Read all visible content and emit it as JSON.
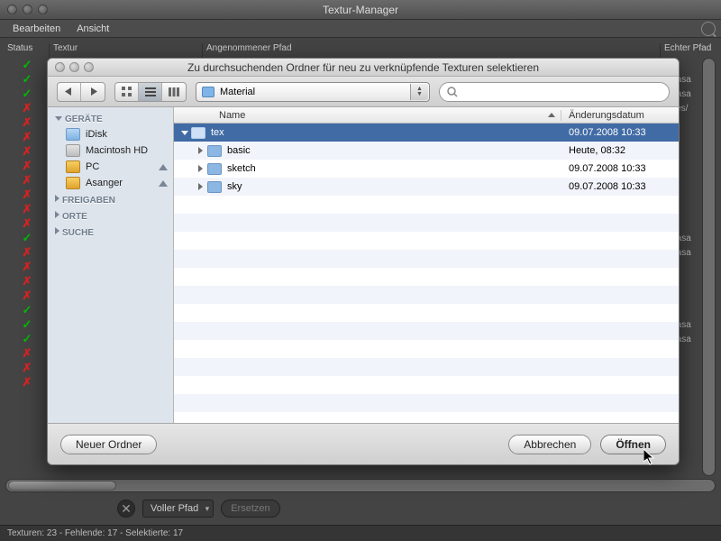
{
  "main": {
    "title": "Textur-Manager",
    "menu": {
      "edit": "Bearbeiten",
      "view": "Ansicht"
    },
    "columns": {
      "status": "Status",
      "textur": "Textur",
      "assumed": "Angenommener Pfad",
      "real": "Echter Pfad"
    },
    "status_rows": [
      {
        "ok": true,
        "path": ""
      },
      {
        "ok": true,
        "path": "ers/asa"
      },
      {
        "ok": true,
        "path": "ers/asa"
      },
      {
        "ok": false,
        "path": "lumes/"
      },
      {
        "ok": false,
        "path": ""
      },
      {
        "ok": false,
        "path": ""
      },
      {
        "ok": false,
        "path": ""
      },
      {
        "ok": false,
        "path": ""
      },
      {
        "ok": false,
        "path": ""
      },
      {
        "ok": false,
        "path": ""
      },
      {
        "ok": false,
        "path": ""
      },
      {
        "ok": false,
        "path": ""
      },
      {
        "ok": true,
        "path": "ers/asa"
      },
      {
        "ok": false,
        "path": "ers/asa"
      },
      {
        "ok": false,
        "path": ""
      },
      {
        "ok": false,
        "path": ""
      },
      {
        "ok": false,
        "path": ""
      },
      {
        "ok": true,
        "path": ""
      },
      {
        "ok": true,
        "path": "ers/asa"
      },
      {
        "ok": true,
        "path": "ers/asa"
      },
      {
        "ok": false,
        "path": ""
      },
      {
        "ok": false,
        "path": ""
      },
      {
        "ok": false,
        "path": ""
      }
    ],
    "path_mode": "Voller Pfad",
    "replace": "Ersetzen",
    "statusline": "Texturen: 23 - Fehlende: 17 - Selektierte: 17"
  },
  "dlg": {
    "title": "Zu durchsuchenden Ordner für neu zu verknüpfende Texturen selektieren",
    "location": "Material",
    "search_placeholder": "",
    "sidebar": {
      "devices": "GERÄTE",
      "shares": "FREIGABEN",
      "places": "ORTE",
      "search": "SUCHE",
      "items": [
        {
          "label": "iDisk",
          "icon": "idisk",
          "eject": false
        },
        {
          "label": "Macintosh HD",
          "icon": "hd",
          "eject": false
        },
        {
          "label": "PC",
          "icon": "pc",
          "eject": true
        },
        {
          "label": "Asanger",
          "icon": "as",
          "eject": true
        }
      ]
    },
    "list": {
      "col_name": "Name",
      "col_date": "Änderungsdatum",
      "rows": [
        {
          "name": "tex",
          "date": "09.07.2008 10:33",
          "expanded": true,
          "depth": 0,
          "selected": true
        },
        {
          "name": "basic",
          "date": "Heute, 08:32",
          "expanded": false,
          "depth": 1,
          "selected": false
        },
        {
          "name": "sketch",
          "date": "09.07.2008 10:33",
          "expanded": false,
          "depth": 1,
          "selected": false
        },
        {
          "name": "sky",
          "date": "09.07.2008 10:33",
          "expanded": false,
          "depth": 1,
          "selected": false
        }
      ]
    },
    "buttons": {
      "new_folder": "Neuer Ordner",
      "cancel": "Abbrechen",
      "open": "Öffnen"
    }
  }
}
